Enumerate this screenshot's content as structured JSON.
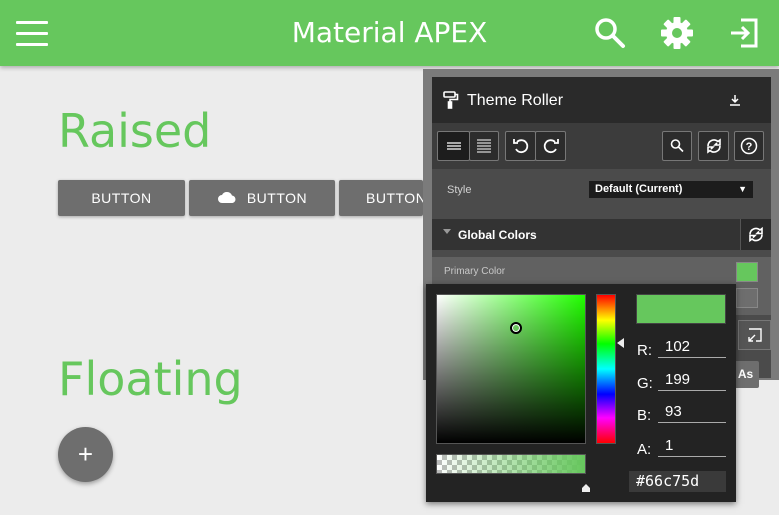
{
  "header": {
    "title": "Material APEX",
    "bg_color": "#66c75d",
    "icons": [
      "menu-icon",
      "search-icon",
      "gear-icon",
      "logout-icon"
    ]
  },
  "main": {
    "raised_heading": "Raised",
    "floating_heading": "Floating",
    "buttons": [
      {
        "label": "BUTTON"
      },
      {
        "label": "BUTTON",
        "icon": "cloud-icon"
      },
      {
        "label": "BUTTON"
      }
    ],
    "fab_label": "+",
    "accent_color": "#66c75d"
  },
  "theme_roller": {
    "title": "Theme Roller",
    "style_label": "Style",
    "style_value": "Default (Current)",
    "group_label": "Global Colors",
    "rows": [
      {
        "label": "Primary Color",
        "color": "#66c75d"
      },
      {
        "label": "",
        "color": "#6e6e6e"
      }
    ],
    "save_as_label": "As"
  },
  "color_picker": {
    "r_label": "R:",
    "g_label": "G:",
    "b_label": "B:",
    "a_label": "A:",
    "r": "102",
    "g": "199",
    "b": "93",
    "a": "1",
    "hex": "#66c75d",
    "color": "#66c75d"
  }
}
